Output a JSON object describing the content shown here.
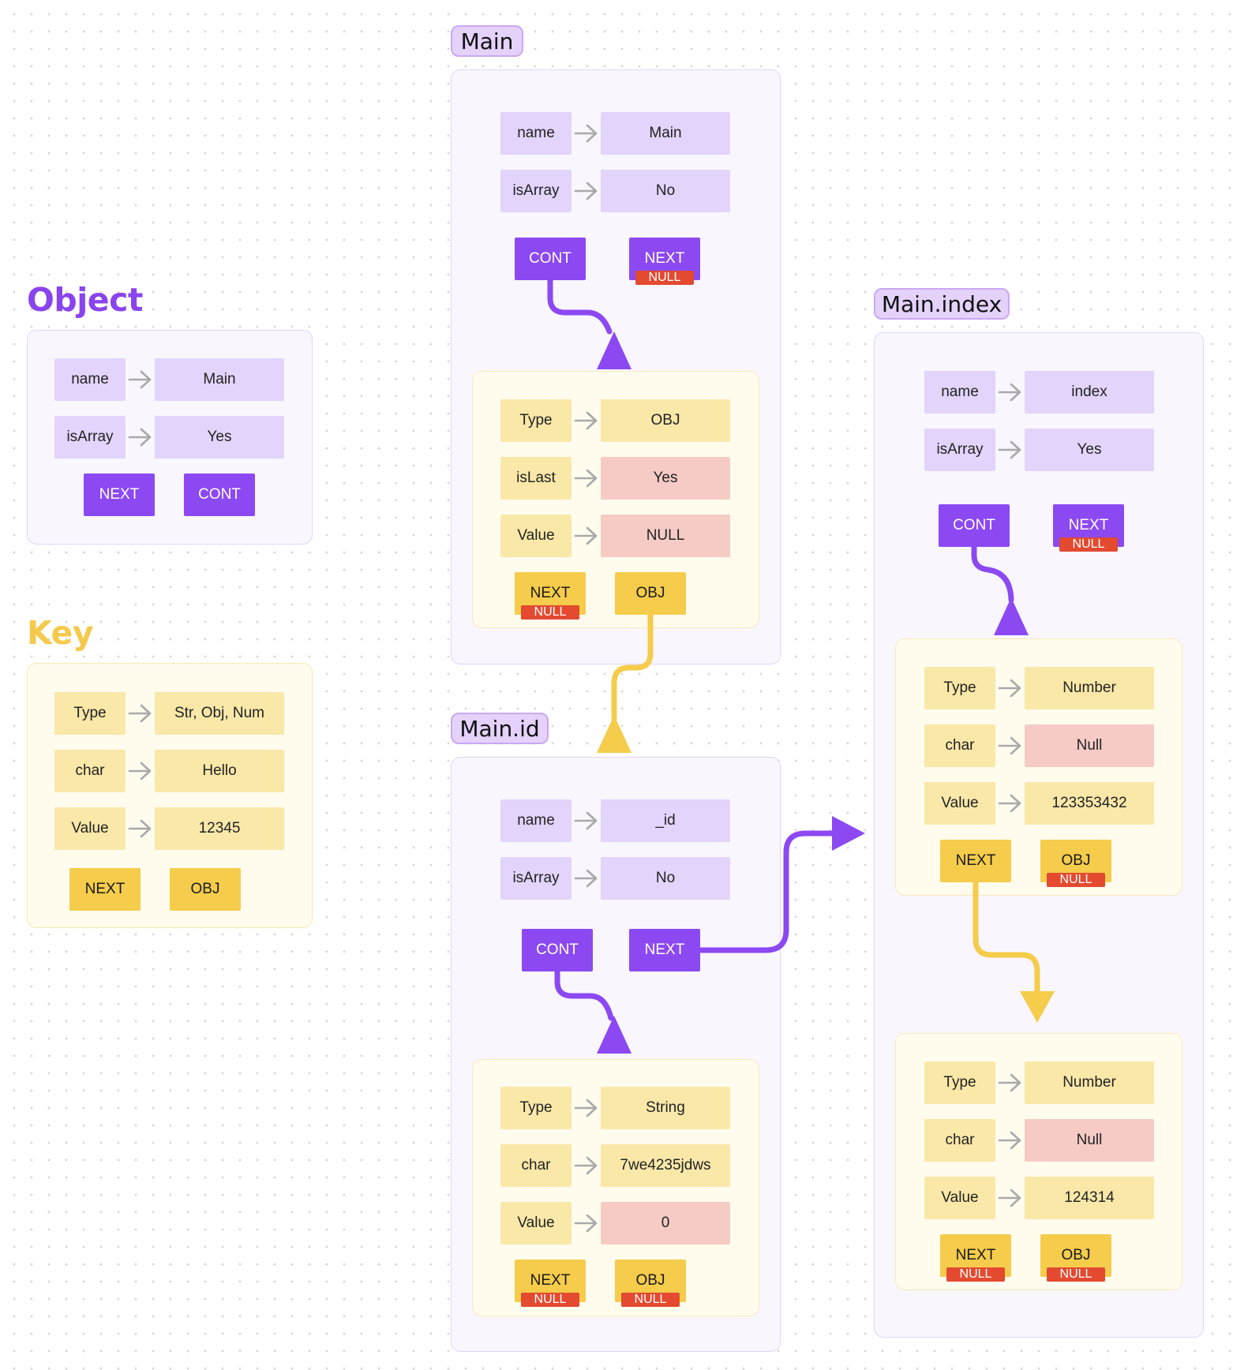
{
  "legend": {
    "object": {
      "title": "Object",
      "name_key": "name",
      "name_val": "Main",
      "isarray_key": "isArray",
      "isarray_val": "Yes",
      "next": "NEXT",
      "cont": "CONT"
    },
    "key": {
      "title": "Key",
      "type_key": "Type",
      "type_val": "Str, Obj, Num",
      "char_key": "char",
      "char_val": "Hello",
      "value_key": "Value",
      "value_val": "12345",
      "next": "NEXT",
      "obj": "OBJ"
    }
  },
  "main": {
    "tag": "Main",
    "name_key": "name",
    "name_val": "Main",
    "isarray_key": "isArray",
    "isarray_val": "No",
    "cont": "CONT",
    "next": "NEXT",
    "next_null": "NULL",
    "key": {
      "type_key": "Type",
      "type_val": "OBJ",
      "islast_key": "isLast",
      "islast_val": "Yes",
      "value_key": "Value",
      "value_val": "NULL",
      "next": "NEXT",
      "next_null": "NULL",
      "obj": "OBJ"
    }
  },
  "main_id": {
    "tag": "Main.id",
    "name_key": "name",
    "name_val": "_id",
    "isarray_key": "isArray",
    "isarray_val": "No",
    "cont": "CONT",
    "next": "NEXT",
    "key": {
      "type_key": "Type",
      "type_val": "String",
      "char_key": "char",
      "char_val": "7we4235jdws",
      "value_key": "Value",
      "value_val": "0",
      "next": "NEXT",
      "next_null": "NULL",
      "obj": "OBJ",
      "obj_null": "NULL"
    }
  },
  "main_index": {
    "tag": "Main.index",
    "name_key": "name",
    "name_val": "index",
    "isarray_key": "isArray",
    "isarray_val": "Yes",
    "cont": "CONT",
    "next": "NEXT",
    "next_null": "NULL",
    "key1": {
      "type_key": "Type",
      "type_val": "Number",
      "char_key": "char",
      "char_val": "Null",
      "value_key": "Value",
      "value_val": "123353432",
      "next": "NEXT",
      "obj": "OBJ",
      "obj_null": "NULL"
    },
    "key2": {
      "type_key": "Type",
      "type_val": "Number",
      "char_key": "char",
      "char_val": "Null",
      "value_key": "Value",
      "value_val": "124314",
      "next": "NEXT",
      "next_null": "NULL",
      "obj": "OBJ",
      "obj_null": "NULL"
    }
  },
  "colors": {
    "purple": "#8c49f2",
    "lavender": "#e2d4fb",
    "yellow": "#f5cc4b",
    "cream": "#fae8a9",
    "pink": "#f6cbc6",
    "null_red": "#e34a30",
    "arrow_grey": "#a9a9a9"
  }
}
